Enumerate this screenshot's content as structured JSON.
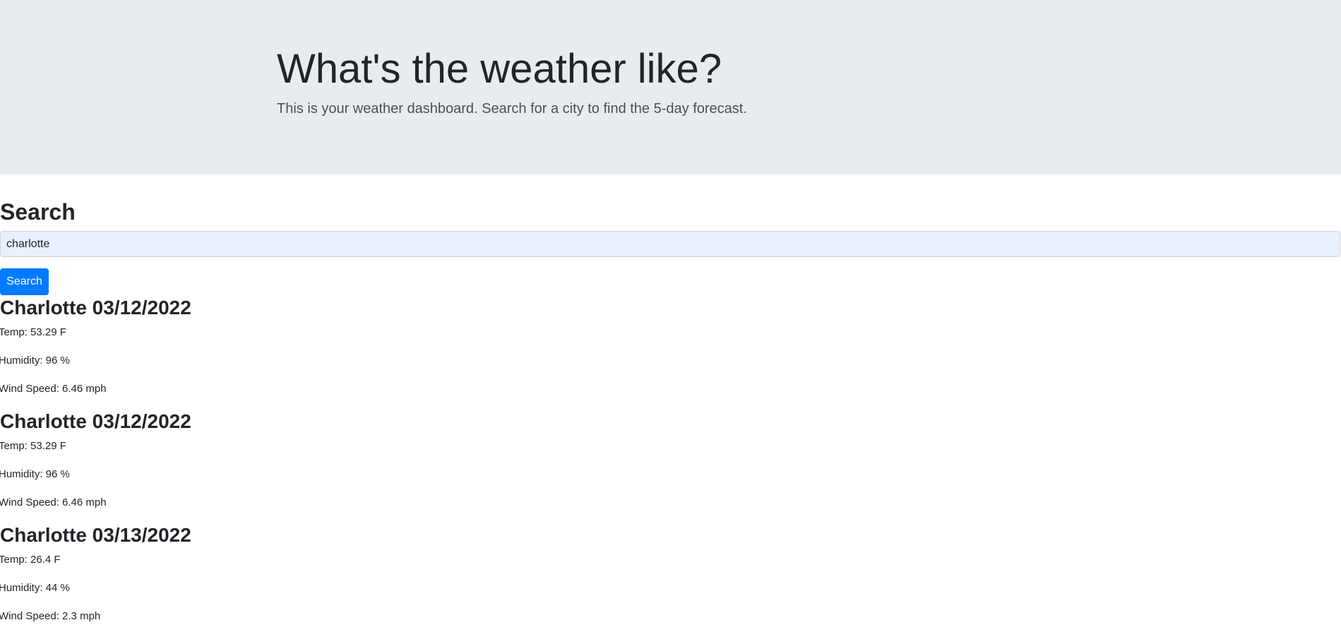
{
  "header": {
    "title": "What's the weather like?",
    "subtitle": "This is your weather dashboard. Search for a city to find the 5-day forecast."
  },
  "search": {
    "heading": "Search",
    "input_value": "charlotte",
    "button_label": "Search"
  },
  "results": [
    {
      "title": "Charlotte 03/12/2022",
      "temp": "Temp: 53.29 F",
      "humidity": "Humidity: 96 %",
      "wind": "Wind Speed: 6.46 mph"
    },
    {
      "title": "Charlotte 03/12/2022",
      "temp": "Temp: 53.29 F",
      "humidity": "Humidity: 96 %",
      "wind": "Wind Speed: 6.46 mph"
    },
    {
      "title": "Charlotte 03/13/2022",
      "temp": "Temp: 26.4 F",
      "humidity": "Humidity: 44 %",
      "wind": "Wind Speed: 2.3 mph"
    }
  ],
  "colors": {
    "header_bg": "#e9ecef",
    "button_bg": "#007bff",
    "input_bg": "#e8f0fe",
    "text": "#212529"
  }
}
